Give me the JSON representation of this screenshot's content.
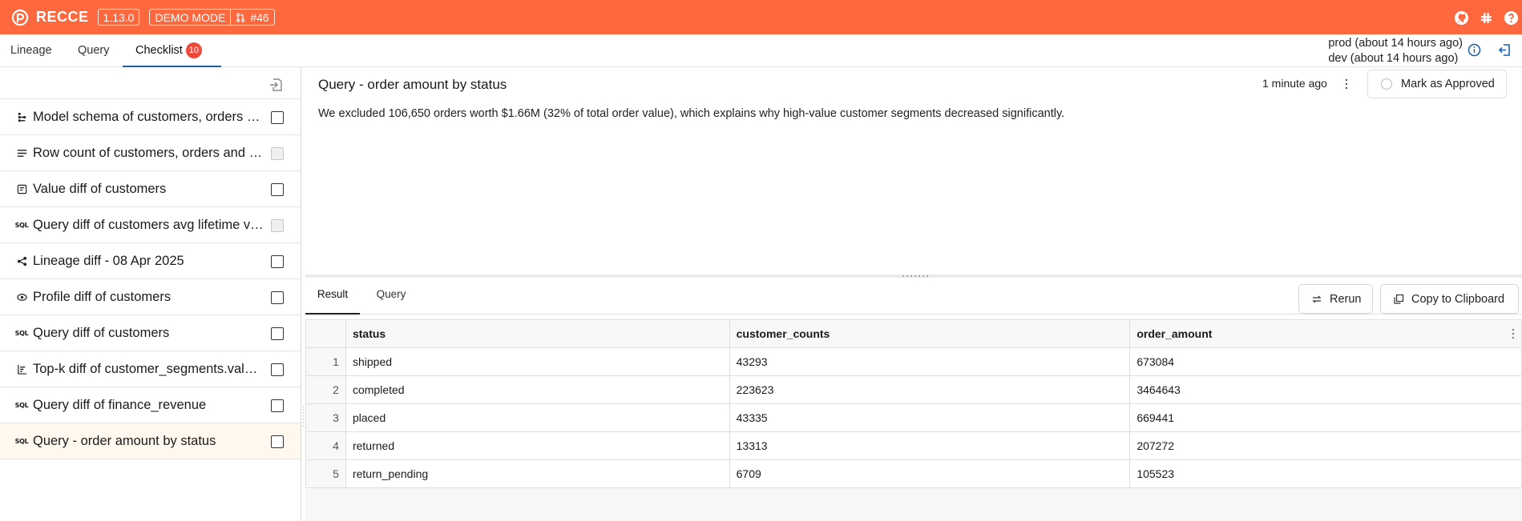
{
  "app": {
    "brand": "RECCE",
    "version": "1.13.0",
    "mode": "DEMO MODE",
    "pr": "#46"
  },
  "tabs": [
    {
      "label": "Lineage"
    },
    {
      "label": "Query"
    },
    {
      "label": "Checklist",
      "badge": "10"
    }
  ],
  "env": {
    "prod": "prod (about 14 hours ago)",
    "dev": "dev (about 14 hours ago)"
  },
  "checklist": [
    {
      "label": "Model schema of customers, orders and modified nodes",
      "icon": "schema-icon"
    },
    {
      "label": "Row count of customers, orders and modified nodes",
      "icon": "row-count-icon"
    },
    {
      "label": "Value diff of customers",
      "icon": "value-diff-icon"
    },
    {
      "label": "Query diff of customers avg lifetime value",
      "icon": "sql-icon"
    },
    {
      "label": "Lineage diff - 08 Apr 2025",
      "icon": "lineage-icon"
    },
    {
      "label": "Profile diff of customers",
      "icon": "profile-icon"
    },
    {
      "label": "Query diff of customers",
      "icon": "sql-icon"
    },
    {
      "label": "Top-k diff of customer_segments.value_segment",
      "icon": "topk-icon"
    },
    {
      "label": "Query diff of finance_revenue",
      "icon": "sql-icon"
    },
    {
      "label": "Query - order amount by status",
      "icon": "sql-icon"
    }
  ],
  "check": {
    "title": "Query - order amount by status",
    "updated": "1 minute ago",
    "approve_label": "Mark as Approved",
    "description": "We excluded 106,650 orders worth $1.66M (32% of total order value), which explains why high-value customer segments decreased significantly."
  },
  "result": {
    "tabs": [
      "Result",
      "Query"
    ],
    "rerun_label": "Rerun",
    "copy_label": "Copy to Clipboard",
    "columns": [
      "status",
      "customer_counts",
      "order_amount"
    ],
    "rows": [
      [
        "1",
        "shipped",
        "43293",
        "673084"
      ],
      [
        "2",
        "completed",
        "223623",
        "3464643"
      ],
      [
        "3",
        "placed",
        "43335",
        "669441"
      ],
      [
        "4",
        "returned",
        "13313",
        "207272"
      ],
      [
        "5",
        "return_pending",
        "6709",
        "105523"
      ]
    ]
  },
  "colors": {
    "topbar": "#fd683e",
    "tab_active": "#1a5fa8",
    "badge": "#ee4a3b",
    "selected_row": "#fff8ef"
  }
}
